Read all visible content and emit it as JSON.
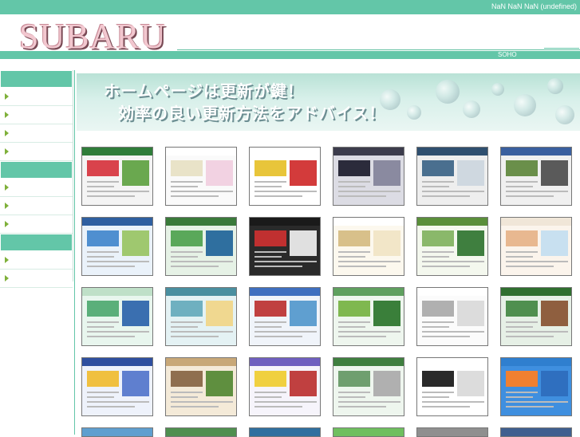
{
  "header": {
    "date_text": "NaN NaN NaN (undefined)",
    "logo_text": "SUBARU",
    "tagline": "SOHO"
  },
  "sidebar": {
    "sections": [
      {
        "heading": "",
        "items": [
          "",
          "",
          "",
          ""
        ]
      },
      {
        "heading": "",
        "items": [
          "",
          "",
          ""
        ]
      },
      {
        "heading": "",
        "items": [
          "",
          ""
        ]
      }
    ]
  },
  "banner": {
    "line1": "ホームページは更新が鍵！",
    "line2": "効率の良い更新方法をアドバイス！"
  },
  "gallery": {
    "thumbnails": [
      {
        "header": "#2f7d3a",
        "bg": "#f4f4f4",
        "a": "#d9434c",
        "b": "#6aa84f"
      },
      {
        "header": "#ffffff",
        "bg": "#fafafa",
        "a": "#e9e3c8",
        "b": "#f2d2e2"
      },
      {
        "header": "#ffffff",
        "bg": "#ffffff",
        "a": "#e8c53a",
        "b": "#d33b3b"
      },
      {
        "header": "#3c3c4c",
        "bg": "#dcdce4",
        "a": "#2b2b3b",
        "b": "#8a8aa0"
      },
      {
        "header": "#2f4f6f",
        "bg": "#eeeeee",
        "a": "#4a6f8f",
        "b": "#cfd8e0"
      },
      {
        "header": "#3a5f9f",
        "bg": "#f0f0f0",
        "a": "#6a8f4a",
        "b": "#5a5a5a"
      },
      {
        "header": "#2f5fa0",
        "bg": "#eaf2fa",
        "a": "#4f8fd0",
        "b": "#9fc86f"
      },
      {
        "header": "#3a7a3a",
        "bg": "#e6f2e6",
        "a": "#5aa85a",
        "b": "#2f6f9f"
      },
      {
        "header": "#1a1a1a",
        "bg": "#2a2a2a",
        "a": "#c03030",
        "b": "#e0e0e0"
      },
      {
        "header": "#ffffff",
        "bg": "#fcf8ee",
        "a": "#d8c08a",
        "b": "#f2e6c8"
      },
      {
        "header": "#5a8f3a",
        "bg": "#f4f8ee",
        "a": "#8ab86a",
        "b": "#3f7f3f"
      },
      {
        "header": "#f0e6d8",
        "bg": "#fbf4ec",
        "a": "#e8b890",
        "b": "#c8e0f0"
      },
      {
        "header": "#bfe0c8",
        "bg": "#e8f6ee",
        "a": "#5aaf7a",
        "b": "#3a6fb0"
      },
      {
        "header": "#4a8fa0",
        "bg": "#e4f2f4",
        "a": "#6fb0c0",
        "b": "#f0d890"
      },
      {
        "header": "#3f6fbf",
        "bg": "#f0f4fa",
        "a": "#c04040",
        "b": "#5f9fd0"
      },
      {
        "header": "#5fa05f",
        "bg": "#eef6ee",
        "a": "#7fb84f",
        "b": "#3a7f3a"
      },
      {
        "header": "#ffffff",
        "bg": "#fbfbfb",
        "a": "#b0b0b0",
        "b": "#dcdcdc"
      },
      {
        "header": "#2f6f2f",
        "bg": "#e6f0e6",
        "a": "#4f8f4f",
        "b": "#8f5f3f"
      },
      {
        "header": "#2f4f9f",
        "bg": "#eef2fb",
        "a": "#f0c040",
        "b": "#5f7fcf"
      },
      {
        "header": "#c8a878",
        "bg": "#f4ead8",
        "a": "#8f6f4f",
        "b": "#5f8f3f"
      },
      {
        "header": "#6f5fbf",
        "bg": "#f6f4fb",
        "a": "#f0d040",
        "b": "#c04040"
      },
      {
        "header": "#3f7f3f",
        "bg": "#eef6ee",
        "a": "#6f9f6f",
        "b": "#b0b0b0"
      },
      {
        "header": "#ffffff",
        "bg": "#ffffff",
        "a": "#2a2a2a",
        "b": "#dcdcdc"
      },
      {
        "header": "#2f7fcf",
        "bg": "#3f8fdf",
        "a": "#f08030",
        "b": "#2f6fbf"
      }
    ],
    "partial_row_colors": [
      "#5f9fcf",
      "#4f8f4f",
      "#2f6f9f",
      "#6fbf5f",
      "#8f8f8f",
      "#3f5f8f"
    ]
  }
}
